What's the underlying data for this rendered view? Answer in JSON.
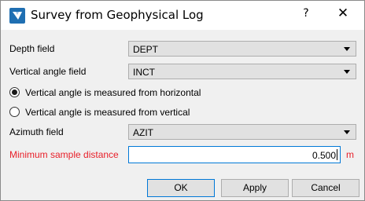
{
  "window": {
    "title": "Survey from Geophysical Log",
    "help_label": "?",
    "close_label": "✕",
    "app_icon": "funnel-v-icon"
  },
  "form": {
    "depth_field": {
      "label": "Depth field",
      "value": "DEPT"
    },
    "vertical_angle_field": {
      "label": "Vertical angle field",
      "value": "INCT"
    },
    "angle_reference": {
      "options": [
        {
          "label": "Vertical angle is measured from horizontal",
          "selected": true
        },
        {
          "label": "Vertical angle is measured from vertical",
          "selected": false
        }
      ]
    },
    "azimuth_field": {
      "label": "Azimuth field",
      "value": "AZIT"
    },
    "min_sample_distance": {
      "label": "Minimum sample distance",
      "value": "0.500",
      "unit": "m"
    }
  },
  "buttons": {
    "ok": "OK",
    "apply": "Apply",
    "cancel": "Cancel"
  },
  "colors": {
    "accent": "#0078d7",
    "required_label": "#e8202a",
    "logo_blue": "#1f6fb2"
  }
}
